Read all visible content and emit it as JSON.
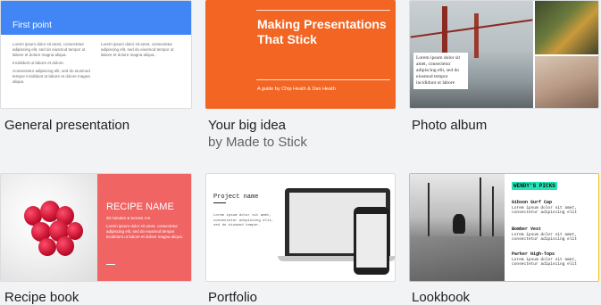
{
  "templates": [
    {
      "name": "General presentation",
      "preview": {
        "title": "First point",
        "col1": [
          "Lorem ipsum dolor sit amet, consectetur adipiscing elit, sed do eiusmod tempor ut labore et dolore magna aliqua.",
          "Incididunt ut labore et dolore.",
          "Consectetur adipiscing elit, sed do eiusmod tempor incididunt ut labore et dolore magna aliqua."
        ],
        "col2": [
          "Lorem ipsum dolor sit amet, consectetur adipiscing elit, sed do eiusmod tempor ut labore et dolore magna aliqua."
        ]
      }
    },
    {
      "name": "Your big idea",
      "subtitle": "by Made to Stick",
      "preview": {
        "title": "Making Presentations That Stick",
        "subtitle": "A guide by Chip Heath & Dan Heath"
      }
    },
    {
      "name": "Photo album",
      "preview": {
        "caption": "Lorem ipsum dolor sit amet, consectetur adipiscing elit, sed do eiusmod tempor incididunt ut labore"
      }
    },
    {
      "name": "Recipe book",
      "preview": {
        "title": "RECIPE NAME",
        "meta": "30 minutes ● Serves 4-6",
        "body": "Lorem ipsum dolor sit amet, consectetur adipiscing elit, sed do eiusmod tempor incididunt ut labore et dolore magna aliqua."
      }
    },
    {
      "name": "Portfolio",
      "preview": {
        "title": "Project name",
        "body": "Lorem ipsum dolor sit amet, consectetur adipiscing elit, sed do eiusmod tempor."
      }
    },
    {
      "name": "Lookbook",
      "preview": {
        "logo": "WENDY'S PICKS",
        "items": [
          {
            "name": "Gibson Surf Cap",
            "desc": "Lorem ipsum dolor sit amet, consectetur adipiscing elit"
          },
          {
            "name": "Bomber Vest",
            "desc": "Lorem ipsum dolor sit amet, consectetur adipiscing elit"
          },
          {
            "name": "Parker High-Tops",
            "desc": "Lorem ipsum dolor sit amet, consectetur adipiscing elit"
          }
        ]
      }
    }
  ],
  "colors": {
    "blue": "#4285f4",
    "orange": "#f26522",
    "coral": "#f06464",
    "teal": "#25e3b5",
    "yellow_border": "#f4c20d"
  }
}
